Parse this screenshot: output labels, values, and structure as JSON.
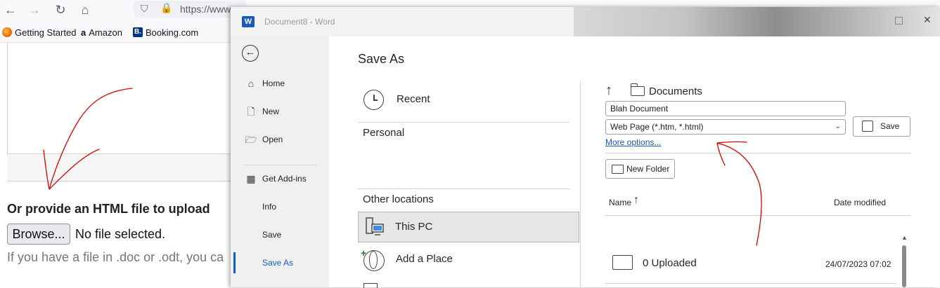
{
  "browser": {
    "url_text": "https://www",
    "bookmarks": [
      {
        "label": "Getting Started"
      },
      {
        "label": "Amazon"
      },
      {
        "label": "Booking.com"
      }
    ]
  },
  "webpage": {
    "upload_heading": "Or provide an HTML file to upload",
    "browse_label": "Browse...",
    "no_file_text": "No file selected.",
    "hint_text": "If you have a file in .doc or .odt, you ca"
  },
  "word": {
    "app_letter": "W",
    "title": "Document8  -  Word",
    "sidebar": {
      "items": [
        {
          "label": "Home",
          "icon": "home-icon"
        },
        {
          "label": "New",
          "icon": "new-document-icon"
        },
        {
          "label": "Open",
          "icon": "open-folder-icon"
        },
        {
          "label": "Get Add-ins",
          "icon": "add-ins-icon"
        },
        {
          "label": "Info",
          "icon": ""
        },
        {
          "label": "Save",
          "icon": ""
        },
        {
          "label": "Save As",
          "icon": "",
          "active": true
        }
      ]
    },
    "save_as": {
      "title": "Save As",
      "locations": {
        "recent": "Recent",
        "personal_header": "Personal",
        "other_header": "Other locations",
        "this_pc": "This PC",
        "add_place": "Add a Place"
      },
      "path": "Documents",
      "filename": "Blah Document",
      "filetype": "Web Page (*.htm, *.html)",
      "save_label": "Save",
      "more_options": "More options...",
      "new_folder": "New Folder",
      "columns": {
        "name": "Name",
        "date": "Date modified"
      },
      "files": [
        {
          "name": "0 Uploaded",
          "date": "24/07/2023 07:02"
        }
      ]
    }
  },
  "colors": {
    "word_blue": "#185abd",
    "annotation_red": "#e00000"
  }
}
